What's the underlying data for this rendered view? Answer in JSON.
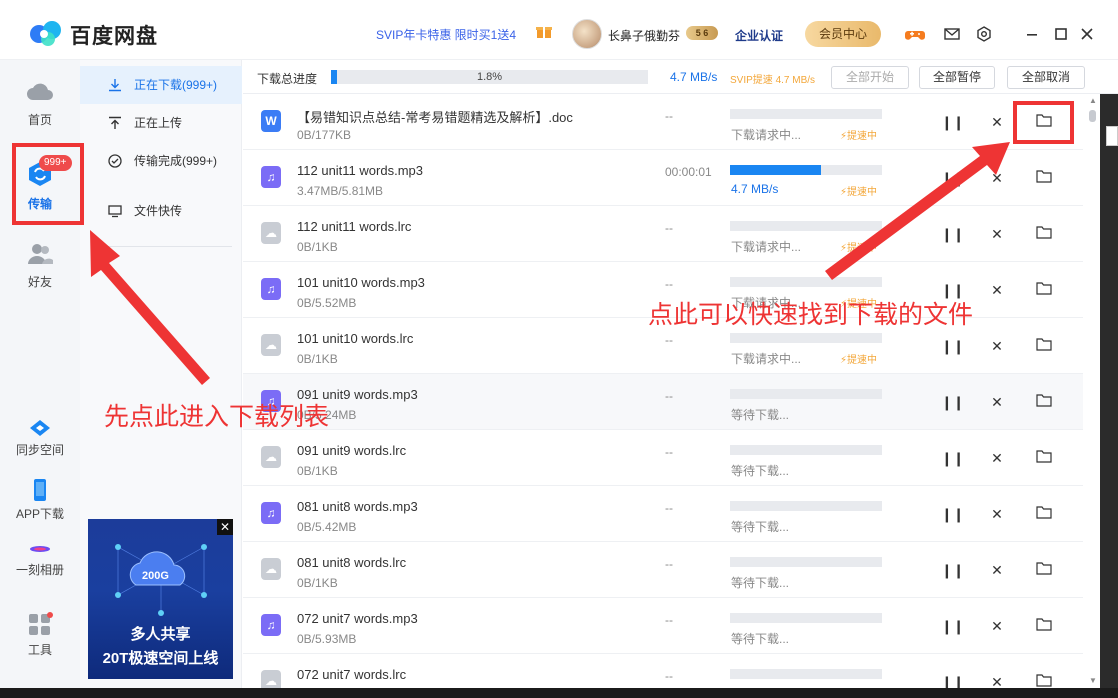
{
  "app": {
    "name": "百度网盘"
  },
  "titlebar": {
    "promo": "SVIP年卡特惠 限时买1送4",
    "username": "长鼻子俄勤芬",
    "vip_badge": "5 6",
    "enterprise": "企业认证",
    "vip_center": "会员中心",
    "icons": [
      "game-icon",
      "mail-icon",
      "settings-icon",
      "minimize-icon",
      "maximize-icon",
      "close-icon"
    ]
  },
  "nav": {
    "home": "首页",
    "transfer": "传输",
    "transfer_badge": "999+",
    "friends": "好友",
    "sync": "同步空间",
    "app_download": "APP下载",
    "album": "一刻相册",
    "tools": "工具"
  },
  "submenu": {
    "downloading": "正在下载(999+)",
    "uploading": "正在上传",
    "completed": "传输完成(999+)",
    "quick_send": "文件快传"
  },
  "ad": {
    "badge": "200G",
    "line1": "多人共享",
    "line2": "20T极速空间上线"
  },
  "header": {
    "progress_label": "下载总进度",
    "progress_text": "1.8%",
    "progress_value": 0.018,
    "speed": "4.7 MB/s",
    "svip_speed": "SVIP提速 4.7 MB/s",
    "btn_start_all": "全部开始",
    "btn_pause_all": "全部暂停",
    "btn_cancel_all": "全部取消"
  },
  "files": [
    {
      "name": "【易错知识点总结-常考易错题精选及解析】.doc",
      "size": "0B/177KB",
      "time": "--",
      "status": "下载请求中...",
      "boost": "提速中",
      "type": "doc",
      "progress": 0
    },
    {
      "name": "112 unit11 words.mp3",
      "size": "3.47MB/5.81MB",
      "time": "00:00:01",
      "status": "4.7 MB/s",
      "boost": "提速中",
      "type": "mp3",
      "progress": 0.6
    },
    {
      "name": "112 unit11 words.lrc",
      "size": "0B/1KB",
      "time": "--",
      "status": "下载请求中...",
      "boost": "提速中",
      "type": "lrc",
      "progress": 0
    },
    {
      "name": "101 unit10 words.mp3",
      "size": "0B/5.52MB",
      "time": "--",
      "status": "下载请求中...",
      "boost": "提速中",
      "type": "mp3",
      "progress": 0
    },
    {
      "name": "101 unit10 words.lrc",
      "size": "0B/1KB",
      "time": "--",
      "status": "下载请求中...",
      "boost": "提速中",
      "type": "lrc",
      "progress": 0
    },
    {
      "name": "091 unit9 words.mp3",
      "size": "0B/5.24MB",
      "time": "--",
      "status": "等待下载...",
      "boost": "",
      "type": "mp3",
      "progress": 0
    },
    {
      "name": "091 unit9 words.lrc",
      "size": "0B/1KB",
      "time": "--",
      "status": "等待下载...",
      "boost": "",
      "type": "lrc",
      "progress": 0
    },
    {
      "name": "081 unit8 words.mp3",
      "size": "0B/5.42MB",
      "time": "--",
      "status": "等待下载...",
      "boost": "",
      "type": "mp3",
      "progress": 0
    },
    {
      "name": "081 unit8 words.lrc",
      "size": "0B/1KB",
      "time": "--",
      "status": "等待下载...",
      "boost": "",
      "type": "lrc",
      "progress": 0
    },
    {
      "name": "072 unit7 words.mp3",
      "size": "0B/5.93MB",
      "time": "--",
      "status": "等待下载...",
      "boost": "",
      "type": "mp3",
      "progress": 0
    },
    {
      "name": "072 unit7 words.lrc",
      "size": "",
      "time": "--",
      "status": "",
      "boost": "",
      "type": "lrc",
      "progress": 0
    }
  ],
  "annotations": {
    "left_text": "先点此进入下载列表",
    "right_text": "点此可以快速找到下载的文件",
    "color": "#ee3434"
  },
  "colors": {
    "accent": "#1a86f2",
    "boost": "#f3a73a",
    "annotation": "#ee3434"
  }
}
